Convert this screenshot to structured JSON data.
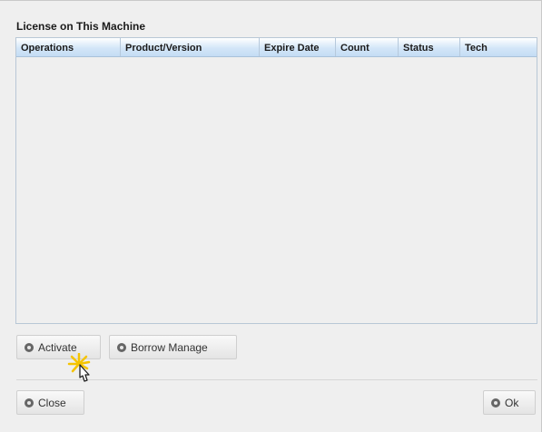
{
  "section": {
    "title": "License on This Machine"
  },
  "table": {
    "columns": [
      "Operations",
      "Product/Version",
      "Expire Date",
      "Count",
      "Status",
      "Tech"
    ],
    "rows": []
  },
  "buttons": {
    "activate": "Activate",
    "borrow_manage": "Borrow Manage",
    "close": "Close",
    "ok": "Ok"
  },
  "icons": {
    "button_icon": "settings-dot-icon",
    "cursor": "hand-pointer-cursor-icon"
  },
  "colors": {
    "dialog_bg": "#efefef",
    "header_gradient_top": "#ffffff",
    "header_gradient_bottom": "#c4dcf4",
    "cursor_highlight": "#f5c400"
  }
}
